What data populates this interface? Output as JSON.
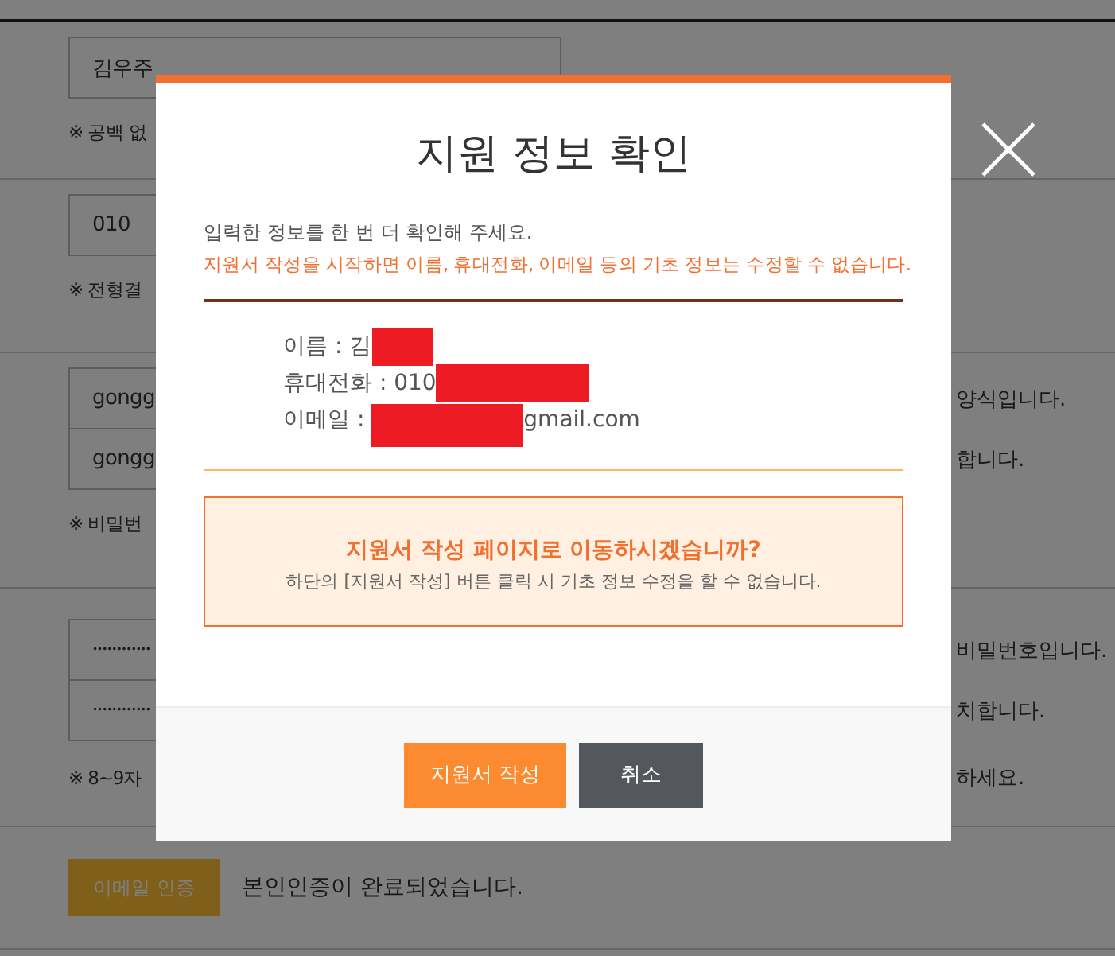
{
  "background_form": {
    "name_value": "김우주",
    "name_hint": "※ 공백 없",
    "phone_value": "010",
    "phone_hint": "※ 전형결",
    "email_fields": [
      {
        "value": "gongg",
        "note": "양식입니다."
      },
      {
        "value": "gongg",
        "note": "합니다."
      }
    ],
    "email_hint": "※ 비밀번",
    "password_fields": [
      {
        "value": "••••••••••••",
        "note": "비밀번호입니다."
      },
      {
        "value": "••••••••••••",
        "note": "치합니다."
      }
    ],
    "password_hint": "※ 8~9자",
    "password_hint_end": "하세요.",
    "verify_button": "이메일 인증",
    "verify_status": "본인인증이 완료되었습니다."
  },
  "modal": {
    "title": "지원 정보 확인",
    "intro": "입력한 정보를 한 번 더 확인해 주세요.",
    "warning": "지원서 작성을 시작하면 이름, 휴대전화, 이메일 등의 기초 정보는 수정할 수 없습니다.",
    "info": [
      {
        "label": "이름 : 김"
      },
      {
        "label": "휴대전화 : 010"
      },
      {
        "label": "이메일 :",
        "suffix": "gmail.com"
      }
    ],
    "notice_title": "지원서 작성 페이지로 이동하시겠습니까?",
    "notice_text": "하단의 [지원서 작성] 버튼 클릭 시 기초 정보 수정을 할 수 없습니다.",
    "buttons": [
      {
        "label": "지원서 작성",
        "kind": "primary"
      },
      {
        "label": "취소",
        "kind": "secondary"
      }
    ]
  }
}
